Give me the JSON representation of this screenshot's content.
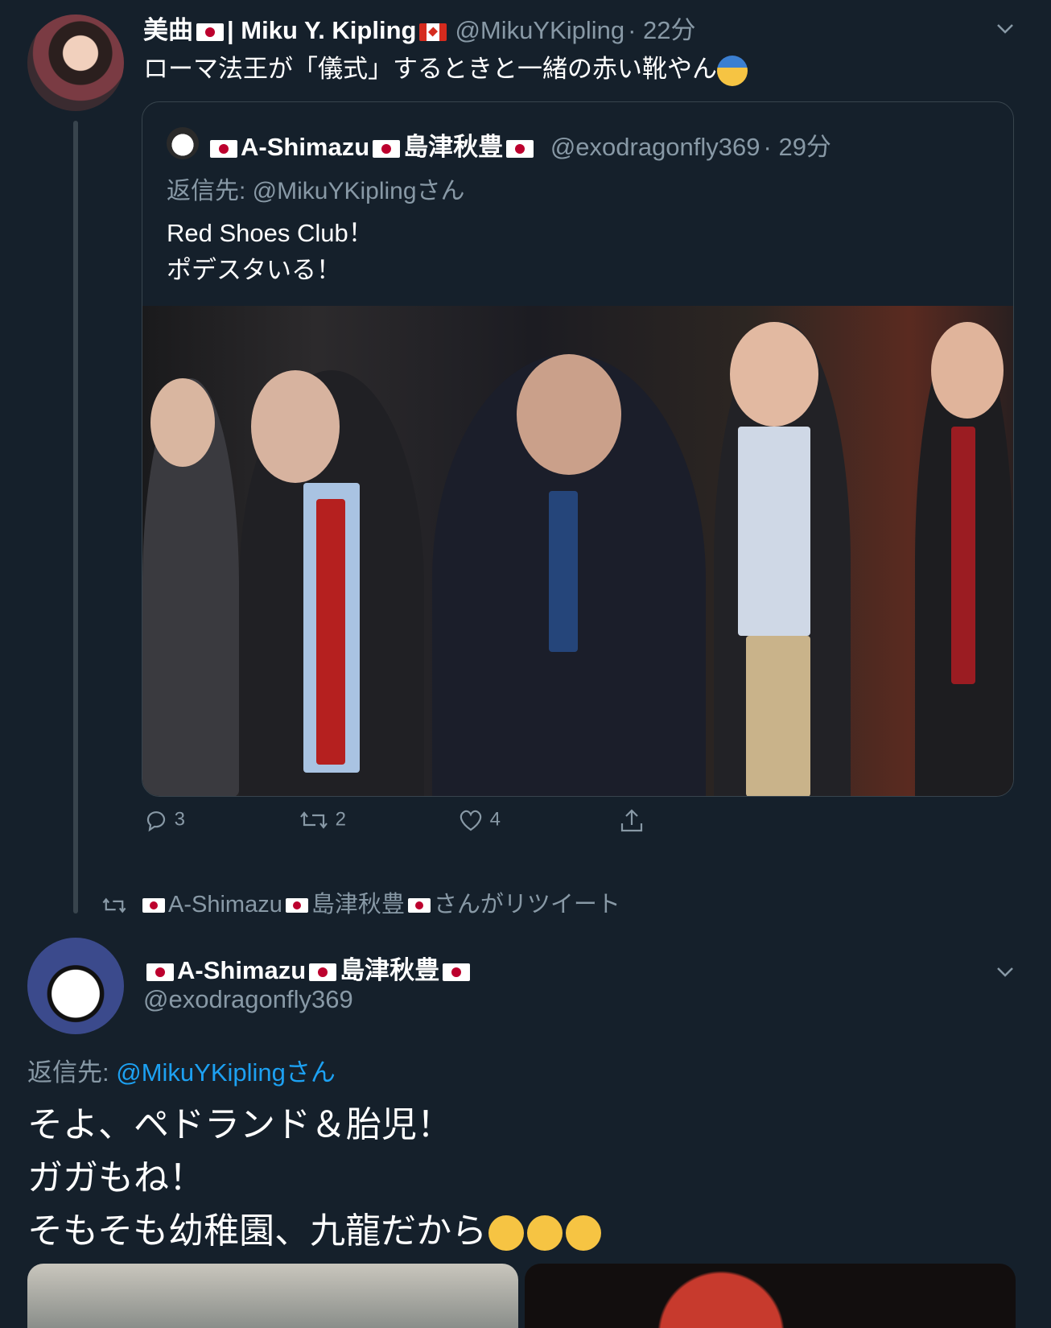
{
  "tweet1": {
    "display_name": "美曲",
    "name_mid": "| Miku Y. Kipling",
    "handle": "@MikuYKipling",
    "time": "· 22分",
    "text": "ローマ法王が「儀式」するときと一緒の赤い靴やん"
  },
  "quote": {
    "name_a": "A-Shimazu",
    "name_b": "島津秋豊",
    "handle": "@exodragonfly369",
    "time": "· 29分",
    "reply_prefix": "返信先: ",
    "reply_handle": "@MikuYKiplingさん",
    "text_line1": "Red Shoes Club！",
    "text_line2": "ポデスタいる！"
  },
  "actions": {
    "reply_count": "3",
    "retweet_count": "2",
    "like_count": "4"
  },
  "retweet_banner": {
    "name_a": "A-Shimazu",
    "name_b": "島津秋豊",
    "suffix": "さんがリツイート"
  },
  "tweet2": {
    "name_a": "A-Shimazu",
    "name_b": "島津秋豊",
    "handle": "@exodragonfly369",
    "reply_prefix": "返信先: ",
    "reply_handle": "@MikuYKiplingさん",
    "line1": "そよ、ペドランド＆胎児！",
    "line2": "ガガもね！",
    "line3": "そもそも幼稚園、九龍だから"
  },
  "colors": {
    "background": "#15202b",
    "secondary_text": "#8899a6",
    "link": "#1da1f2",
    "border": "#38444d"
  }
}
